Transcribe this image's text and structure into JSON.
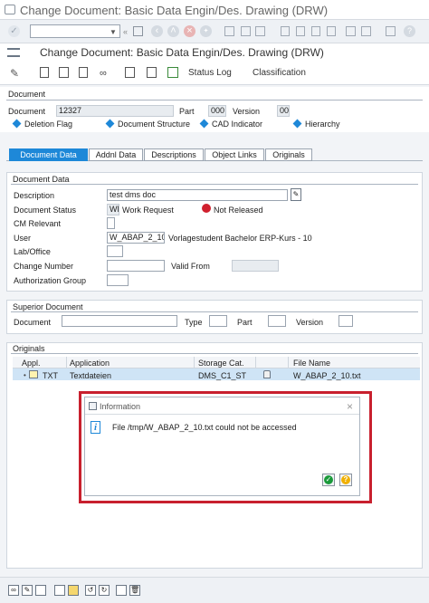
{
  "window": {
    "title": "Change Document: Basic Data Engin/Des. Drawing (DRW)"
  },
  "screen": {
    "title": "Change Document: Basic Data Engin/Des. Drawing (DRW)"
  },
  "toolbar2": {
    "status_log": "Status Log",
    "classification": "Classification"
  },
  "document": {
    "section_label": "Document",
    "document_label": "Document",
    "document_value": "12327",
    "part_label": "Part",
    "part_value": "000",
    "version_label": "Version",
    "version_value": "00",
    "flags": [
      "Deletion Flag",
      "Document Structure",
      "CAD Indicator",
      "Hierarchy"
    ]
  },
  "tabs": [
    "Document Data",
    "Addnl Data",
    "Descriptions",
    "Object Links",
    "Originals"
  ],
  "document_data": {
    "title": "Document Data",
    "description_label": "Description",
    "description_value": "test dms doc",
    "status_label": "Document Status",
    "status_code": "WR",
    "status_text": "Work Request",
    "release_status": "Not Released",
    "cm_relevant_label": "CM Relevant",
    "user_label": "User",
    "user_value": "W_ABAP_2_10",
    "user_name": "Vorlagestudent Bachelor ERP-Kurs - 10",
    "lab_label": "Lab/Office",
    "change_number_label": "Change Number",
    "valid_from_label": "Valid From",
    "auth_group_label": "Authorization Group"
  },
  "superior": {
    "title": "Superior Document",
    "document_label": "Document",
    "type_label": "Type",
    "part_label": "Part",
    "version_label": "Version"
  },
  "originals": {
    "title": "Originals",
    "columns": [
      "Appl.",
      "Application",
      "Storage Cat.",
      "File Name"
    ],
    "row": {
      "appl": "TXT",
      "application": "Textdateien",
      "storage": "DMS_C1_ST",
      "file": "W_ABAP_2_10.txt"
    }
  },
  "dialog": {
    "title": "Information",
    "message": "File /tmp/W_ABAP_2_10.txt could not be accessed",
    "close_glyph": "×"
  },
  "colors": {
    "accent": "#1e88d8",
    "error_red": "#d0202e",
    "frame_red": "#c8202e",
    "ok_green": "#1a9a3a",
    "help_yellow": "#f0b000"
  }
}
